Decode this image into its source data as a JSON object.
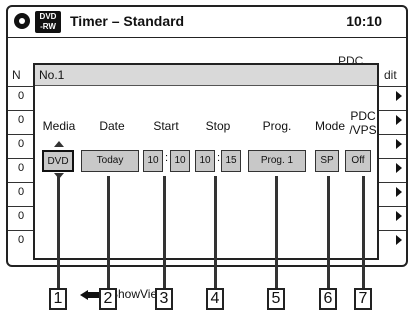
{
  "header": {
    "title": "Timer – Standard",
    "clock": "10:10",
    "badge_line1": "DVD",
    "badge_line2": "-RW"
  },
  "background_table": {
    "col_start": "N",
    "col_pdc": "PDC",
    "col_edit": "dit",
    "rows": [
      "0",
      "0",
      "0",
      "0",
      "0",
      "0",
      "0"
    ]
  },
  "dialog": {
    "title": "No.1",
    "columns": {
      "media": "Media",
      "date": "Date",
      "start": "Start",
      "stop": "Stop",
      "prog": "Prog.",
      "mode": "Mode",
      "pdc_line1": "PDC",
      "pdc_line2": "/VPS"
    },
    "values": {
      "media": "DVD",
      "date": "Today",
      "start_hour": "10",
      "start_min": "10",
      "stop_hour": "10",
      "stop_min": "15",
      "prog": "Prog. 1",
      "mode": "SP",
      "pdc": "Off"
    },
    "showview": "ShowView"
  },
  "callouts": [
    "1",
    "2",
    "3",
    "4",
    "5",
    "6",
    "7"
  ]
}
